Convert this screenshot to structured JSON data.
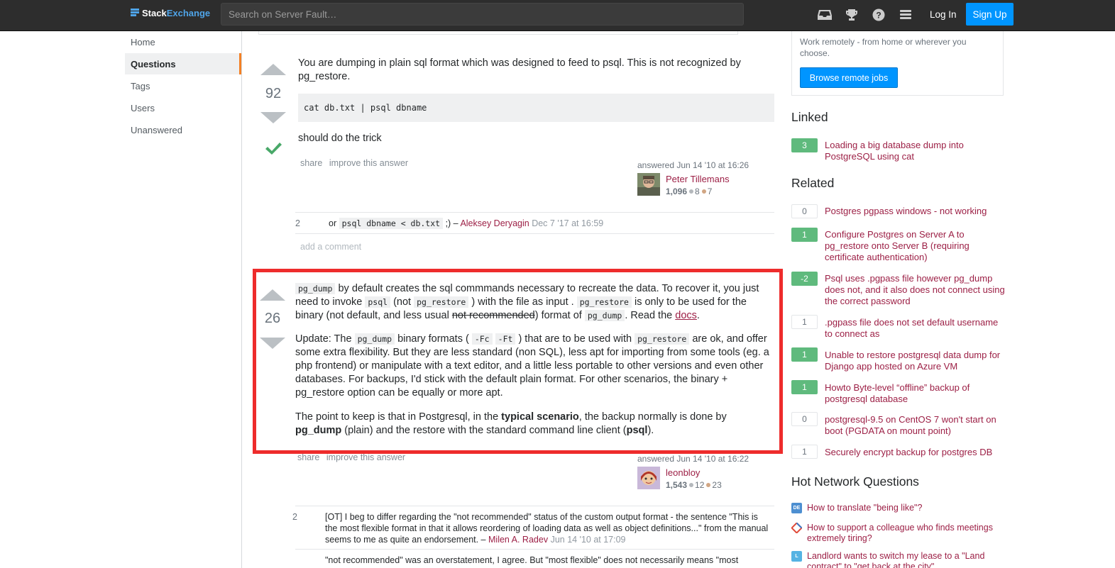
{
  "topbar": {
    "logo_part1": "Stack",
    "logo_part2": "Exchange",
    "search_placeholder": "Search on Server Fault…",
    "login": "Log In",
    "signup": "Sign Up",
    "icons": [
      "inbox-icon",
      "trophy-icon",
      "help-icon",
      "site-switcher-icon"
    ]
  },
  "nav": {
    "items": [
      "Home",
      "Questions",
      "Tags",
      "Users",
      "Unanswered"
    ],
    "active": "Questions"
  },
  "answer1": {
    "votes": "92",
    "p1": "You are dumping in plain sql format which was designed to feed to psql. This is not recognized by pg_restore.",
    "code": "cat db.txt | psql dbname",
    "p2": "should do the trick",
    "share": "share",
    "improve": "improve this answer",
    "answered": "answered Jun 14 '10 at 16:26",
    "user": "Peter Tillemans",
    "rep": "1,096",
    "silver": "8",
    "bronze": "7",
    "comments": [
      {
        "score": "2",
        "pre": "or",
        "code": "psql dbname < db.txt",
        "post": ";) –",
        "user": "Aleksey Deryagin",
        "time": "Dec 7 '17 at 16:59"
      }
    ],
    "add_comment": "add a comment"
  },
  "answer2": {
    "votes": "26",
    "p1": {
      "c1": "pg_dump",
      "t1": " by default creates the sql commmands necessary to recreate the data. To recover it, you just need to invoke ",
      "c2": "psql",
      "t2": " (not ",
      "c3": "pg_restore",
      "t3": " ) with the file as input . ",
      "c4": "pg_restore",
      "t4": " is only to be used for the binary (not default, and less usual ",
      "strike": "not recommended",
      "t5": ") format of ",
      "c5": "pg_dump",
      "t6": ". Read the ",
      "link": "docs",
      "t7": "."
    },
    "p2": {
      "t1": "Update: The ",
      "c1": "pg_dump",
      "t2": " binary formats ( ",
      "c2": "-Fc",
      "c3": "-Ft",
      "t3": " ) that are to be used with ",
      "c4": "pg_restore",
      "t4": " are ok, and offer some extra flexibility. But they are less standard (non SQL), less apt for importing from some tools (eg. a php frontend) or manipulate with a text editor, and a little less portable to other versions and even other databases. For backups, I'd stick with the default plain format. For other scenarios, the binary + pg_restore option can be equally or more apt."
    },
    "p3": {
      "t1": "The point to keep is that in Postgresql, in the ",
      "b1": "typical scenario",
      "t2": ", the backup normally is done by ",
      "b2": "pg_dump",
      "t3": " (plain) and the restore with the standard command line client (",
      "b3": "psql",
      "t4": ")."
    },
    "share": "share",
    "improve": "improve this answer",
    "answered": "answered Jun 14 '10 at 16:22",
    "user": "leonbloy",
    "rep": "1,543",
    "silver": "12",
    "bronze": "23",
    "comments": [
      {
        "score": "2",
        "text": "[OT] I beg to differ regarding the \"not recommended\" status of the custom output format - the sentence \"This is the most flexible format in that it allows reordering of loading data as well as object definitions...\" from the manual seems to me as quite an endorsement. –",
        "user": "Milen A. Radev",
        "time": "Jun 14 '10 at 17:09"
      },
      {
        "score": "",
        "text": "\"not recommended\" was an overstatement, I agree. But \"most flexible\" does not necessarily means \"most"
      }
    ]
  },
  "sidebar": {
    "promo_text": "Work remotely - from home or wherever you choose.",
    "promo_button": "Browse remote jobs",
    "linked_title": "Linked",
    "linked": [
      {
        "score": "3",
        "title": "Loading a big database dump into PostgreSQL using cat"
      }
    ],
    "related_title": "Related",
    "related": [
      {
        "score": "0",
        "title": "Postgres pgpass windows - not working"
      },
      {
        "score": "1",
        "title": "Configure Postgres on Server A to pg_restore onto Server B (requiring certificate authentication)"
      },
      {
        "score": "-2",
        "title": "Psql uses .pgpass file however pg_dump does not, and it also does not connect using the correct password"
      },
      {
        "score": "1",
        "title": ".pgpass file does not set default username to connect as"
      },
      {
        "score": "1",
        "title": "Unable to restore postgresql data dump for Django app hosted on Azure VM"
      },
      {
        "score": "1",
        "title": "Howto Byte-level “offline” backup of postgresql database"
      },
      {
        "score": "0",
        "title": "postgresql-9.5 on CentOS 7 won't start on boot (PGDATA on mount point)"
      },
      {
        "score": "1",
        "title": "Securely encrypt backup for postgres DB"
      }
    ],
    "hnq_title": "Hot Network Questions",
    "hnq": [
      {
        "icon": "DE",
        "title": "How to translate \"being like\"?"
      },
      {
        "icon": "",
        "title": "How to support a colleague who finds meetings extremely tiring?"
      },
      {
        "icon": "L",
        "title": "Landlord wants to switch my lease to a \"Land contract\" to \"get back at the city\""
      }
    ]
  },
  "colors": {
    "accent_link": "#9c1f45",
    "highlight_border": "#ee2c2c",
    "score_positive": "#5fba7d",
    "button_blue": "#0095ff"
  }
}
